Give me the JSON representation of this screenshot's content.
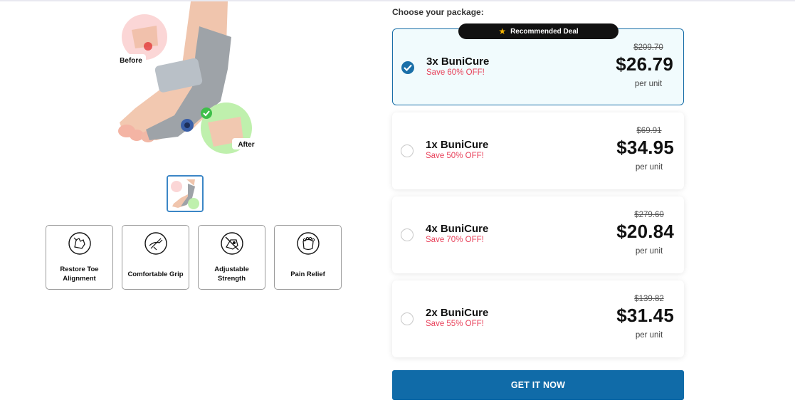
{
  "product_gallery": {
    "before_label": "Before",
    "after_label": "After",
    "features": [
      {
        "icon": "alignment-icon",
        "label": "Restore Toe Alignment"
      },
      {
        "icon": "comfort-icon",
        "label": "Comfortable Grip"
      },
      {
        "icon": "adjustable-icon",
        "label": "Adjustable Strength"
      },
      {
        "icon": "foot-relief-icon",
        "label": "Pain Relief"
      }
    ]
  },
  "packages": {
    "heading": "Choose your package:",
    "recommended_label": "Recommended Deal",
    "items": [
      {
        "name": "3x BuniCure",
        "save": "Save 60% OFF!",
        "old_price": "$209.70",
        "price": "$26.79",
        "unit": "per unit",
        "selected": true
      },
      {
        "name": "1x BuniCure",
        "save": "Save 50% OFF!",
        "old_price": "$69.91",
        "price": "$34.95",
        "unit": "per unit",
        "selected": false
      },
      {
        "name": "4x BuniCure",
        "save": "Save 70% OFF!",
        "old_price": "$279.60",
        "price": "$20.84",
        "unit": "per unit",
        "selected": false
      },
      {
        "name": "2x BuniCure",
        "save": "Save 55% OFF!",
        "old_price": "$139.82",
        "price": "$31.45",
        "unit": "per unit",
        "selected": false
      }
    ],
    "cta_label": "GET IT NOW"
  },
  "colors": {
    "accent": "#106ba8",
    "save_red": "#e8415a",
    "selected_bg": "#f1fbfd"
  }
}
